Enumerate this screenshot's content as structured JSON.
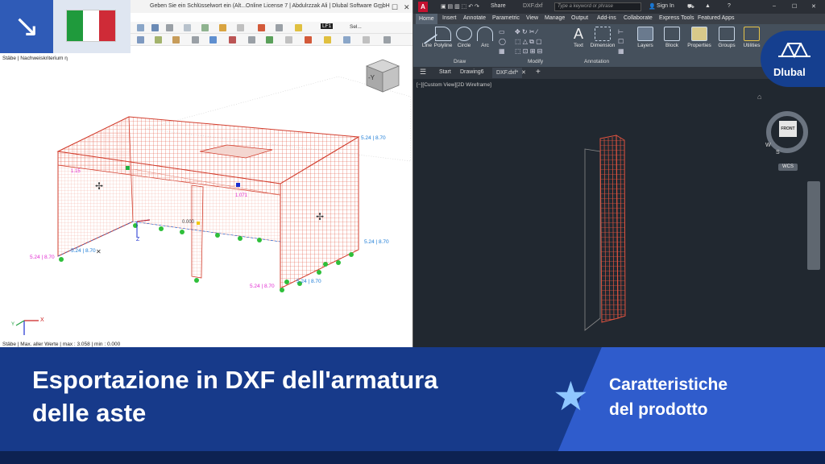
{
  "badge": {
    "arrow_icon": "↘",
    "flag_colors": [
      "#1f9a3c",
      "#ffffff",
      "#cf2b37"
    ]
  },
  "rfem": {
    "tabs": [
      "Geben Sie ein Schlüsselwort ein (Alt...",
      "Online License 7 | Abdulrzzak Ali | Dlubal Software GmbH"
    ],
    "toolbar_lc": "LF1",
    "toolbar_sel": "Sel...",
    "info_top": "Stäbe | Nachweiskriterium η",
    "info_bottom": "Stäbe | Max. aller Werte | max : 3.058 | min : 0.000",
    "view_cube_label": "-Y",
    "labels": {
      "tl": "5.24 | 8.70",
      "left": "5.24 | 8.70",
      "left2": "5.24 | 8.70",
      "right": "5.24 | 8.70",
      "bottom": "5.24 | 8.70",
      "bottom2": "5.24 | 8.70",
      "mid": "1.071",
      "val0": "0.000",
      "small": "1.15"
    },
    "axis": {
      "x": "X",
      "z": "Z",
      "y": "Y"
    }
  },
  "acad": {
    "share": "Share",
    "file_name": "DXF.dxf",
    "search_placeholder": "Type a keyword or phrase",
    "sign_in": "Sign In",
    "menu_tabs": [
      "Home",
      "Insert",
      "Annotate",
      "Parametric",
      "View",
      "Manage",
      "Output",
      "Add-ins",
      "Collaborate",
      "Express Tools",
      "Featured Apps"
    ],
    "draw_tools": [
      "Line",
      "Polyline",
      "Circle",
      "Arc"
    ],
    "annotation_tools": [
      "Text",
      "Dimension"
    ],
    "panel_tools": [
      "Layers",
      "Block",
      "Properties",
      "Groups",
      "Utilities"
    ],
    "groups": [
      "Draw",
      "Modify",
      "Annotation"
    ],
    "doc_tabs": [
      "Start",
      "Drawing6",
      "DXF.dxf*"
    ],
    "view_label": "[−][Custom View][2D Wireframe]",
    "cube_face": "FRONT",
    "compass": {
      "w": "W",
      "s": "S"
    },
    "wcs": "WCS"
  },
  "brand": {
    "name": "Dlubal"
  },
  "banner": {
    "title_lines": [
      "Esportazione in DXF dell'armatura",
      "delle aste"
    ],
    "category_lines": [
      "Caratteristiche",
      "del prodotto"
    ],
    "star_icon": "★"
  },
  "colors": {
    "accent": "#2f5bb7",
    "banner_dark": "#173a8a",
    "banner_light": "#2f5ccc",
    "rebar": "#e2533f"
  }
}
